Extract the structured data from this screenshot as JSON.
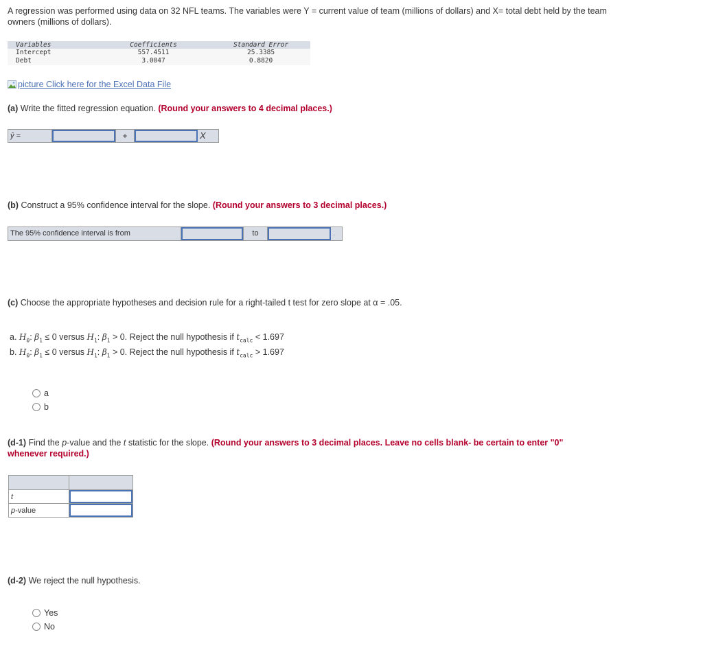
{
  "intro": "A regression was performed using data on 32 NFL teams. The variables were Y = current value of team (millions of dollars) and X= total debt held by the team owners (millions of dollars).",
  "regression_table": {
    "headers": [
      "Variables",
      "Coefficients",
      "Standard Error"
    ],
    "rows": [
      [
        "Intercept",
        "557.4511",
        "25.3385"
      ],
      [
        "Debt",
        "3.0047",
        "0.8820"
      ]
    ]
  },
  "excel_link": {
    "icon": "broken-image-icon",
    "alt": "picture",
    "label": "Click here for the Excel Data File"
  },
  "part_a": {
    "label": "(a)",
    "text": "Write the fitted regression equation.",
    "instruction": "(Round your answers to 4 decimal places.)",
    "yhat_label": "ŷ =",
    "plus": "+",
    "x_label": "X",
    "intercept_value": "",
    "slope_value": ""
  },
  "part_b": {
    "label": "(b)",
    "text": "Construct a 95% confidence interval for the slope.",
    "instruction": "(Round your answers to 3 decimal places.)",
    "row_label": "The 95% confidence interval is from",
    "to": "to",
    "end": ".",
    "lower_value": "",
    "upper_value": ""
  },
  "part_c": {
    "label": "(c)",
    "text": "Choose the appropriate hypotheses and decision rule for a right-tailed t test for zero slope at α = .05.",
    "options": [
      {
        "key": "a.",
        "h0": "H",
        "h0sub": "0",
        "rest1": ": ",
        "beta": "β",
        "betasub": "1",
        "cond0": " ≤ 0 versus ",
        "h1": "H",
        "h1sub": "1",
        "cond1": " > 0. Reject the null hypothesis if ",
        "t": "t",
        "tsub": "calc",
        "rule": " < 1.697"
      },
      {
        "key": "b.",
        "h0": "H",
        "h0sub": "0",
        "rest1": ": ",
        "beta": "β",
        "betasub": "1",
        "cond0": " ≤ 0 versus ",
        "h1": "H",
        "h1sub": "1",
        "cond1": " > 0. Reject the null hypothesis if ",
        "t": "t",
        "tsub": "calc",
        "rule": " > 1.697"
      }
    ],
    "choices": [
      "a",
      "b"
    ]
  },
  "part_d1": {
    "label": "(d-1)",
    "text_pre": "Find the ",
    "p_italic": "p",
    "text_mid": "-value and the ",
    "t_italic": "t",
    "text_post": " statistic for the slope.",
    "instruction": "(Round your answers to 3 decimal places. Leave no cells blank- be certain to enter \"0\" whenever required.)",
    "rows": [
      {
        "label": "t",
        "value": ""
      },
      {
        "label": "p-value",
        "value": ""
      }
    ]
  },
  "part_d2": {
    "label": "(d-2)",
    "text": "We reject the null hypothesis.",
    "choices": [
      "Yes",
      "No"
    ]
  }
}
